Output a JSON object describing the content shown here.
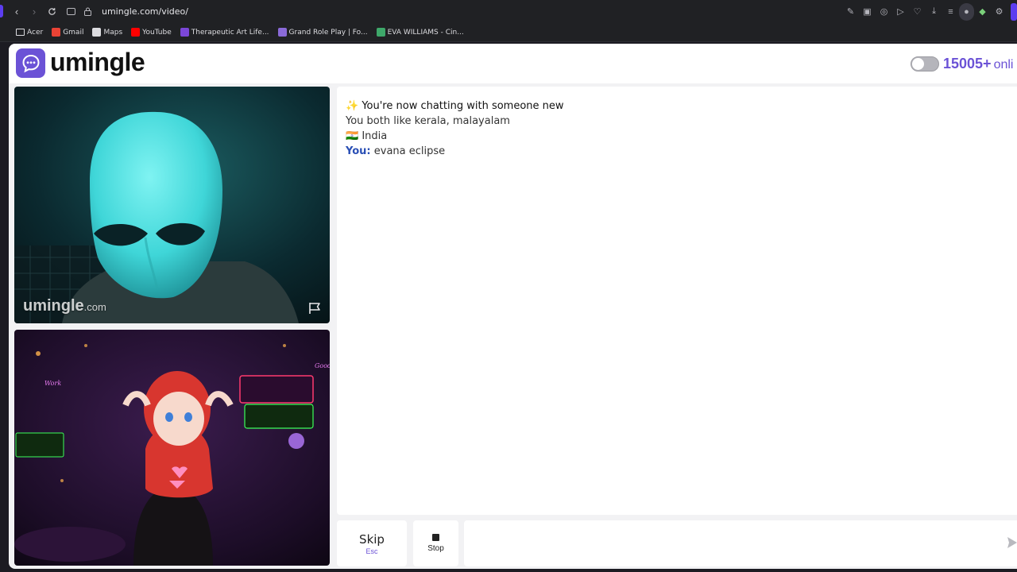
{
  "browser": {
    "url": "umingle.com/video/",
    "bookmarks": [
      {
        "label": "Acer",
        "color": "#00000000",
        "icon": "folder-icon"
      },
      {
        "label": "Gmail",
        "color": "#ea4335",
        "icon": "gmail-icon"
      },
      {
        "label": "Maps",
        "color": "#dcdce0",
        "icon": "document-icon"
      },
      {
        "label": "YouTube",
        "color": "#ff0000",
        "icon": "youtube-icon"
      },
      {
        "label": "Therapeutic Art Life...",
        "color": "#7b47d8",
        "icon": "site-icon"
      },
      {
        "label": "Grand Role Play | Fo...",
        "color": "#8a6ad8",
        "icon": "site-icon"
      },
      {
        "label": "EVA WILLIAMS - Cin...",
        "color": "#3ea86a",
        "icon": "site-icon"
      }
    ]
  },
  "header": {
    "logo_text": "umingle",
    "online_count": "15005+",
    "online_label": "onli"
  },
  "stranger_video": {
    "watermark": "umingle",
    "watermark_suffix": ".com"
  },
  "chat": {
    "system_emoji": "✨",
    "system_line": "You're now chatting with someone new",
    "interests_line": "You both like kerala, malayalam",
    "country_flag": "🇮🇳",
    "country": "India",
    "you_label": "You:",
    "you_message": "evana eclipse"
  },
  "controls": {
    "skip_label": "Skip",
    "skip_hint": "Esc",
    "stop_label": "Stop",
    "message_placeholder": ""
  }
}
